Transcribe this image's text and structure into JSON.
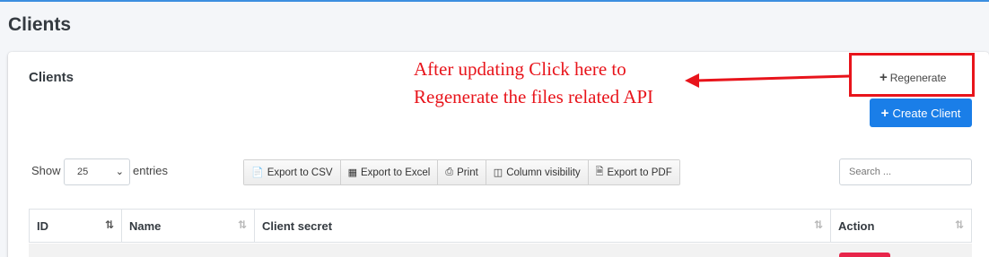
{
  "page": {
    "title": "Clients"
  },
  "card": {
    "title": "Clients"
  },
  "annotation": {
    "text": "After updating Click here to Regenerate the files related API"
  },
  "buttons": {
    "regenerate_label": "Regenerate",
    "create_label": "Create Client"
  },
  "length_menu": {
    "show_label": "Show",
    "entries_label": "entries",
    "selected": "25"
  },
  "export_buttons": [
    {
      "label": "Export to CSV",
      "icon": "file-csv-icon"
    },
    {
      "label": "Export to Excel",
      "icon": "file-excel-icon"
    },
    {
      "label": "Print",
      "icon": "print-icon"
    },
    {
      "label": "Column visibility",
      "icon": "columns-icon"
    },
    {
      "label": "Export to PDF",
      "icon": "file-pdf-icon"
    }
  ],
  "search": {
    "placeholder": "Search ..."
  },
  "table": {
    "columns": [
      "ID",
      "Name",
      "Client secret",
      "Action"
    ]
  },
  "colors": {
    "primary": "#1a7ee8",
    "annotation_red": "#e8141b",
    "danger": "#e8254a",
    "background": "#f4f6f9"
  }
}
